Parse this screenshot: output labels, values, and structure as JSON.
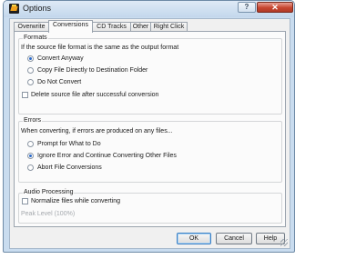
{
  "window": {
    "title": "Options",
    "help_glyph": "?",
    "close_glyph": "✕"
  },
  "tabs": [
    "Overwrite",
    "Conversions",
    "CD Tracks",
    "Other",
    "Right Click"
  ],
  "active_tab": "Conversions",
  "formats": {
    "title": "Formats",
    "prompt": "If the source file format is the same as the output format",
    "options": [
      {
        "label": "Convert Anyway",
        "selected": true
      },
      {
        "label": "Copy File Directly to Destination Folder",
        "selected": false
      },
      {
        "label": "Do Not Convert",
        "selected": false
      }
    ],
    "delete_checkbox": {
      "label": "Delete source file after successful conversion",
      "checked": false
    }
  },
  "errors": {
    "title": "Errors",
    "prompt": "When converting, if errors are produced on any files...",
    "options": [
      {
        "label": "Prompt for What to Do",
        "selected": false
      },
      {
        "label": "Ignore Error and Continue Converting Other Files",
        "selected": true
      },
      {
        "label": "Abort File Conversions",
        "selected": false
      }
    ]
  },
  "audio": {
    "title": "Audio Processing",
    "normalize_checkbox": {
      "label": "Normalize files while converting",
      "checked": false
    },
    "peak_level": "Peak Level (100%)"
  },
  "buttons": {
    "ok": "OK",
    "cancel": "Cancel",
    "help": "Help"
  }
}
